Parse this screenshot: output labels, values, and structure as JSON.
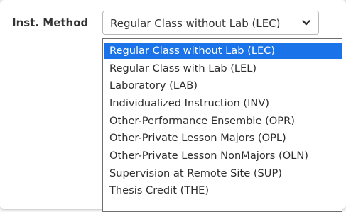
{
  "field": {
    "label": "Inst. Method",
    "selected_value": "Regular Class without Lab (LEC)",
    "chevron_icon": "chevron-down-icon"
  },
  "dropdown": {
    "options": [
      "Regular Class without Lab (LEC)",
      "Regular Class with Lab (LEL)",
      "Laboratory (LAB)",
      "Individualized Instruction (INV)",
      "Other-Performance Ensemble (OPR)",
      "Other-Private Lesson Majors (OPL)",
      "Other-Private Lesson NonMajors (OLN)",
      "Supervision at Remote Site (SUP)",
      "Thesis Credit (THE)"
    ],
    "selected_index": 0
  },
  "colors": {
    "highlight": "#1a73e8",
    "text": "#2e2e2e"
  }
}
